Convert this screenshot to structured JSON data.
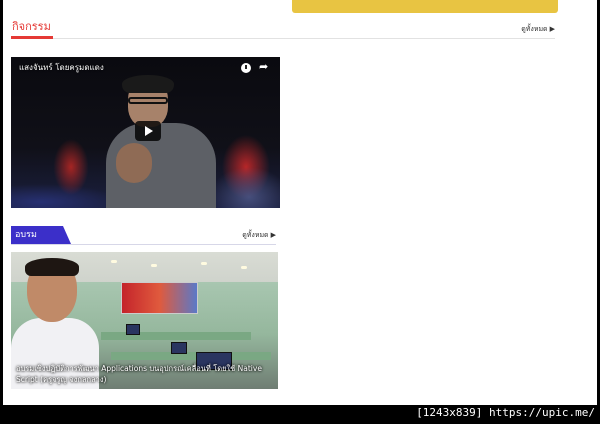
{
  "activity_section": {
    "title": "กิจกรรม",
    "see_all": "ดูทั้งหมด",
    "accent": "#e53935"
  },
  "video": {
    "title": "แสงจันทร์ โดยครูมดแดง",
    "clock_icon": "clock-icon",
    "share_icon": "share-icon",
    "play_icon": "play-icon"
  },
  "training_section": {
    "title": "อบรมสัมมนา",
    "see_all": "ดูทั้งหมด",
    "accent": "#3b2fc9"
  },
  "training_post": {
    "caption": "อบรมเชิงปฏิบัติการพัฒนา Applications บนอุปกรณ์เคลื่อนที่ โดยใช้ Native Script (ครูจรูญ จงกลกลาง)"
  },
  "watermark": {
    "text": "[1243x839] https://upic.me/"
  }
}
